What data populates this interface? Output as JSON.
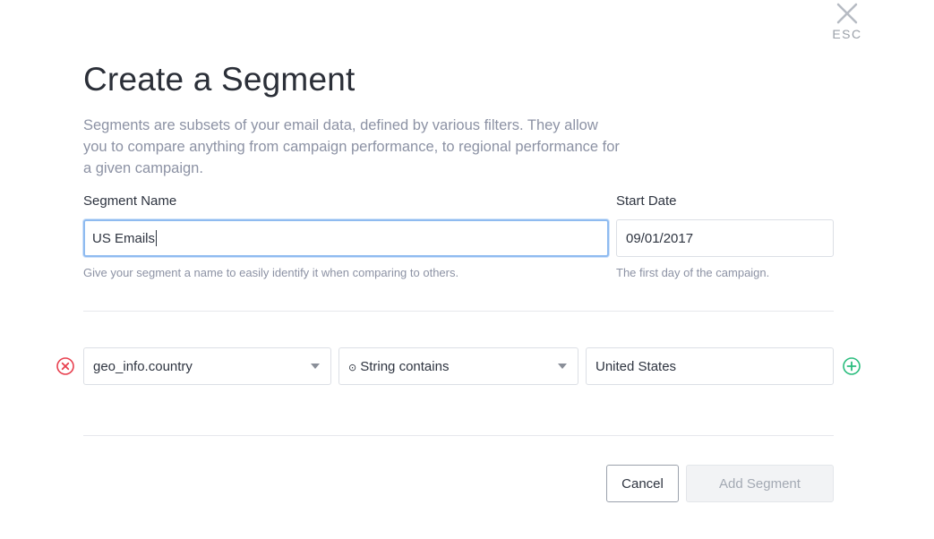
{
  "close": {
    "esc_label": "ESC"
  },
  "header": {
    "title": "Create a Segment",
    "description": "Segments are subsets of your email data, defined by various filters. They allow you to compare anything from campaign performance, to regional performance for a given campaign."
  },
  "segment_name": {
    "label": "Segment Name",
    "value": "US Emails",
    "help": "Give your segment a name to easily identify it when comparing to others."
  },
  "start_date": {
    "label": "Start Date",
    "value": "09/01/2017",
    "help": "The first day of the campaign."
  },
  "filter": {
    "field": "geo_info.country",
    "operator_icon": "⊙",
    "operator": "String contains",
    "value": "United States"
  },
  "colors": {
    "remove": "#e8404f",
    "add": "#2bbd7e",
    "focus": "#8fbbf0"
  },
  "buttons": {
    "cancel": "Cancel",
    "add_segment": "Add Segment"
  }
}
